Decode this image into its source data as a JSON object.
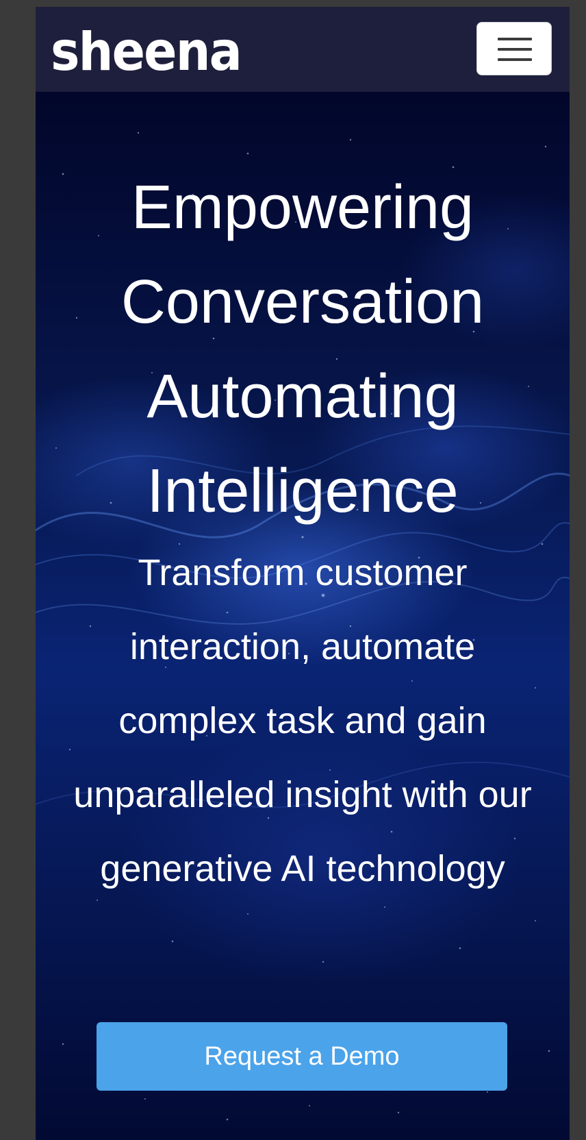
{
  "navbar": {
    "logo_text": "sheena",
    "menu_toggle_icon": "hamburger-menu-icon"
  },
  "hero": {
    "headline": "Empowering Conversation Automating Intelligence",
    "subtitle": "Transform customer interaction, automate complex task and gain unparalleled insight with our generative AI technology",
    "cta_label": "Request a Demo"
  },
  "colors": {
    "navbar_bg": "#1e1f3c",
    "hero_bg": "#071850",
    "cta_bg": "#4ba3ea",
    "text": "#ffffff"
  }
}
